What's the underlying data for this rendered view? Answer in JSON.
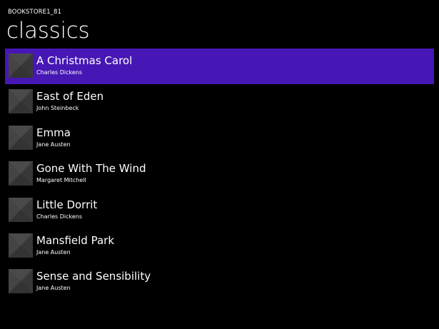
{
  "app": {
    "title": "BOOKSTORE1_81"
  },
  "page": {
    "title": "classics"
  },
  "colors": {
    "background": "#000000",
    "selection": "#4617b4",
    "cover_placeholder": "#3d3d3d",
    "text": "#ffffff"
  },
  "books": [
    {
      "title": "A Christmas Carol",
      "author": "Charles Dickens",
      "selected": true,
      "cover_icon": "book-cover-placeholder-icon"
    },
    {
      "title": "East of Eden",
      "author": "John Steinbeck",
      "selected": false,
      "cover_icon": "book-cover-placeholder-icon"
    },
    {
      "title": "Emma",
      "author": "Jane Austen",
      "selected": false,
      "cover_icon": "book-cover-placeholder-icon"
    },
    {
      "title": "Gone With The Wind",
      "author": "Margaret Mitchell",
      "selected": false,
      "cover_icon": "book-cover-placeholder-icon"
    },
    {
      "title": "Little Dorrit",
      "author": "Charles Dickens",
      "selected": false,
      "cover_icon": "book-cover-placeholder-icon"
    },
    {
      "title": "Mansfield Park",
      "author": "Jane Austen",
      "selected": false,
      "cover_icon": "book-cover-placeholder-icon"
    },
    {
      "title": "Sense and Sensibility",
      "author": "Jane Austen",
      "selected": false,
      "cover_icon": "book-cover-placeholder-icon"
    }
  ]
}
